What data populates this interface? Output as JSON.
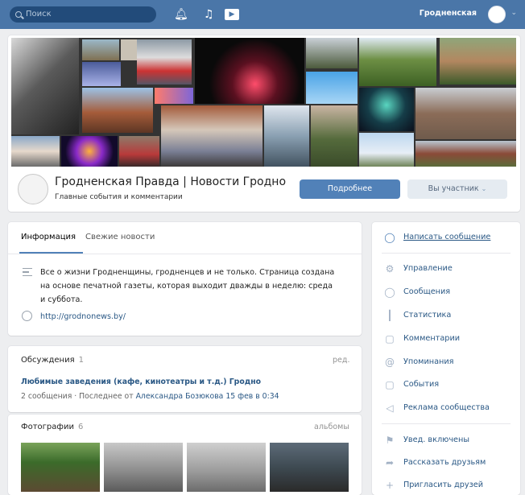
{
  "topbar": {
    "search_placeholder": "Поиск",
    "user_name": "Гродненская"
  },
  "group": {
    "title": "Гродненская Правда | Новости Гродно",
    "subtitle": "Главные события и комментарии",
    "more_button": "Подробнее",
    "member_button": "Вы участник"
  },
  "info": {
    "tabs": [
      "Информация",
      "Свежие новости"
    ],
    "description": "Все о жизни Гродненщины, гродненцев и не только. Страница создана на основе печатной газеты, которая выходит дважды в неделю: среда и суббота.",
    "website": "http://grodnonews.by/"
  },
  "discussions": {
    "title": "Обсуждения",
    "count": "1",
    "edit": "ред.",
    "topic_title": "Любимые заведения (кафе, кинотеатры и т.д.) Гродно",
    "topic_posts": "2 сообщения",
    "topic_last_prefix": " · Последнее от ",
    "topic_last_author": "Александра Бозюкова 15 фев в 0:34"
  },
  "photos": {
    "title": "Фотографии",
    "count": "6",
    "albums": "альбомы"
  },
  "sidebar": {
    "write_message": "Написать сообщение",
    "items": [
      {
        "label": "Управление",
        "icon": "gear-icon"
      },
      {
        "label": "Сообщения",
        "icon": "message-icon"
      },
      {
        "label": "Статистика",
        "icon": "stats-icon"
      },
      {
        "label": "Комментарии",
        "icon": "comment-icon"
      },
      {
        "label": "Упоминания",
        "icon": "at-icon"
      },
      {
        "label": "События",
        "icon": "events-icon"
      },
      {
        "label": "Реклама сообщества",
        "icon": "megaphone-icon"
      }
    ],
    "items2": [
      {
        "label": "Увед. включены",
        "icon": "bell-icon"
      },
      {
        "label": "Рассказать друзьям",
        "icon": "share-icon"
      },
      {
        "label": "Пригласить друзей",
        "icon": "add-user-icon"
      }
    ]
  },
  "colors": {
    "header_blue": "#4a76a8",
    "button_blue": "#5181b8",
    "link_blue": "#2a5885"
  }
}
